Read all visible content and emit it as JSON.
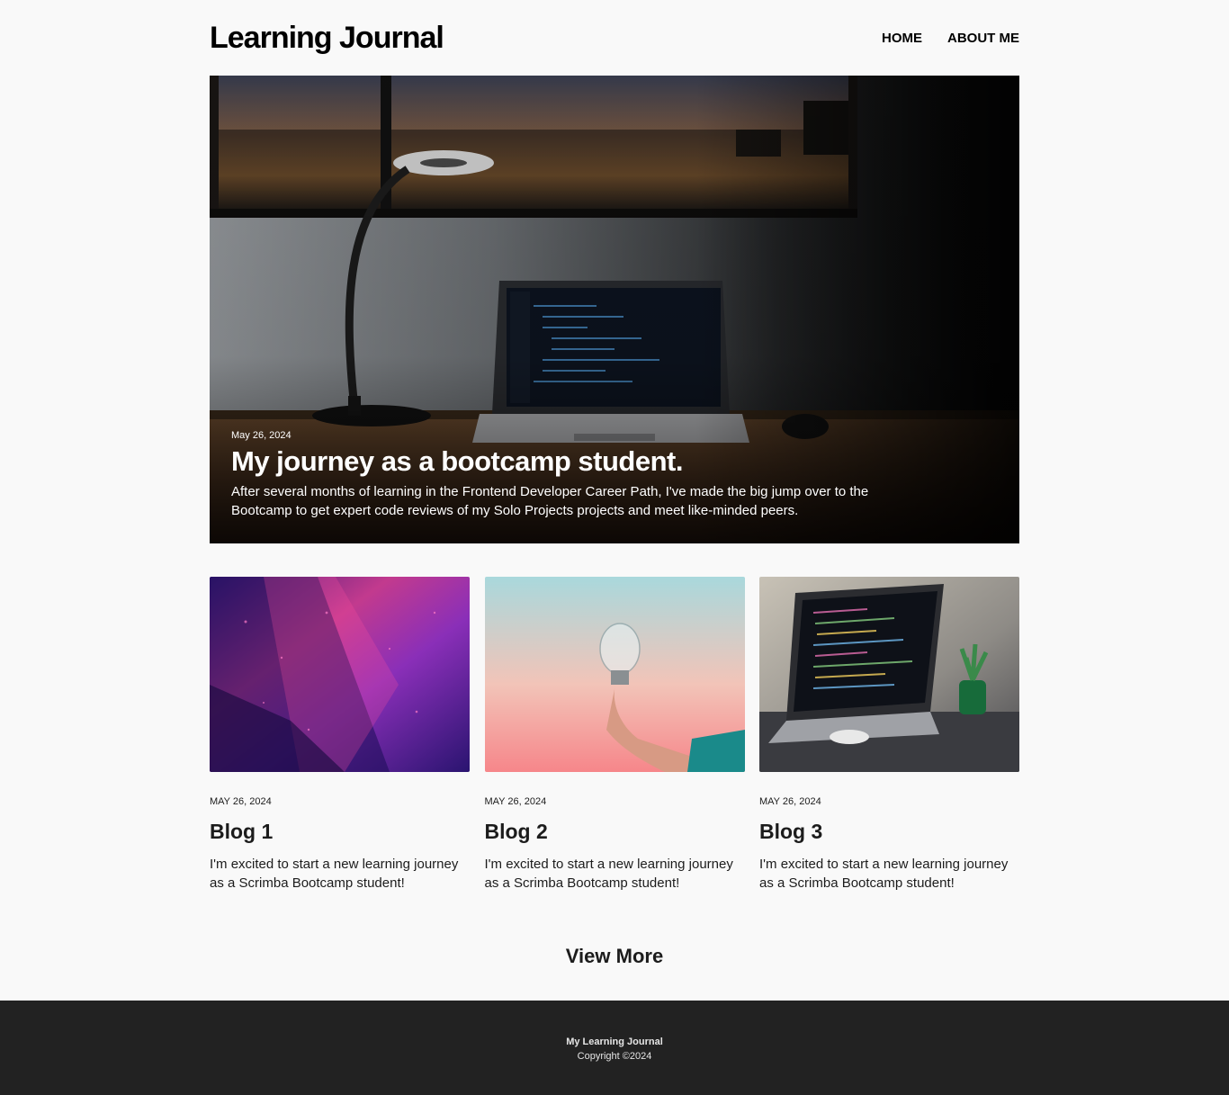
{
  "header": {
    "title": "Learning Journal",
    "nav": [
      {
        "label": "HOME"
      },
      {
        "label": "ABOUT ME"
      }
    ]
  },
  "hero": {
    "date": "May 26, 2024",
    "title": "My journey as a bootcamp student.",
    "description": "After several months of learning in the Frontend Developer Career Path, I've made the big jump over to the Bootcamp to get expert code reviews of my Solo Projects projects and meet like-minded peers.",
    "image": "desk-lamp-laptop-night"
  },
  "posts": [
    {
      "date": "MAY 26, 2024",
      "title": "Blog 1",
      "description": "I'm excited to start a new learning journey as a Scrimba Bootcamp student!",
      "image": "purple-neon-abstract"
    },
    {
      "date": "MAY 26, 2024",
      "title": "Blog 2",
      "description": "I'm excited to start a new learning journey as a Scrimba Bootcamp student!",
      "image": "hand-holding-lightbulb"
    },
    {
      "date": "MAY 26, 2024",
      "title": "Blog 3",
      "description": "I'm excited to start a new learning journey as a Scrimba Bootcamp student!",
      "image": "laptop-code-plant"
    }
  ],
  "view_more": "View More",
  "footer": {
    "title": "My Learning Journal",
    "copyright": "Copyright ©2024"
  },
  "colors": {
    "background": "#f9f9f9",
    "text": "#1c1c1c",
    "footer_bg": "#222222",
    "footer_text": "#e6e6e6"
  }
}
